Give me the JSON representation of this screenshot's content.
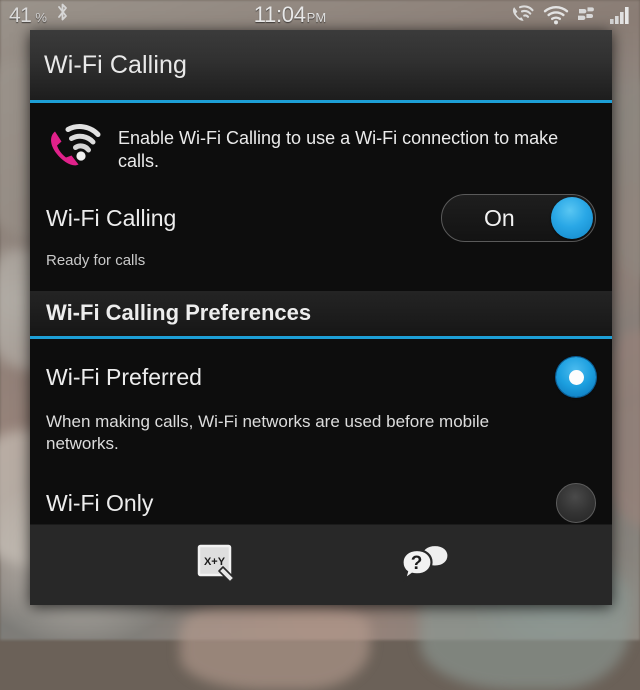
{
  "statusbar": {
    "battery_percent": "41",
    "percent_symbol": "%",
    "bluetooth_icon": "bluetooth-icon",
    "time": "11:04",
    "ampm": "PM",
    "icons": [
      "wifi-calling-icon",
      "wifi-icon",
      "blackberry-logo-icon",
      "signal-bars-icon"
    ]
  },
  "dialog": {
    "title": "Wi-Fi Calling",
    "accent_color": "#1d9fd6",
    "description": {
      "icon": "wifi-calling-phone-icon",
      "text": "Enable Wi-Fi Calling to use a Wi-Fi connection to make calls."
    },
    "setting": {
      "label": "Wi-Fi Calling",
      "toggle_value": "On",
      "toggle_color": "#29a7e6",
      "status": "Ready for calls"
    },
    "preferences": {
      "header": "Wi-Fi Calling Preferences",
      "options": [
        {
          "label": "Wi-Fi Preferred",
          "selected": true,
          "description": "When making calls, Wi-Fi networks are used before mobile networks."
        },
        {
          "label": "Wi-Fi Only",
          "selected": false,
          "description": ""
        }
      ]
    },
    "toolbar": {
      "buttons": [
        {
          "name": "keyboard-shortcuts-icon",
          "label": "X+Y"
        },
        {
          "name": "help-icon",
          "label": "?"
        }
      ]
    }
  }
}
